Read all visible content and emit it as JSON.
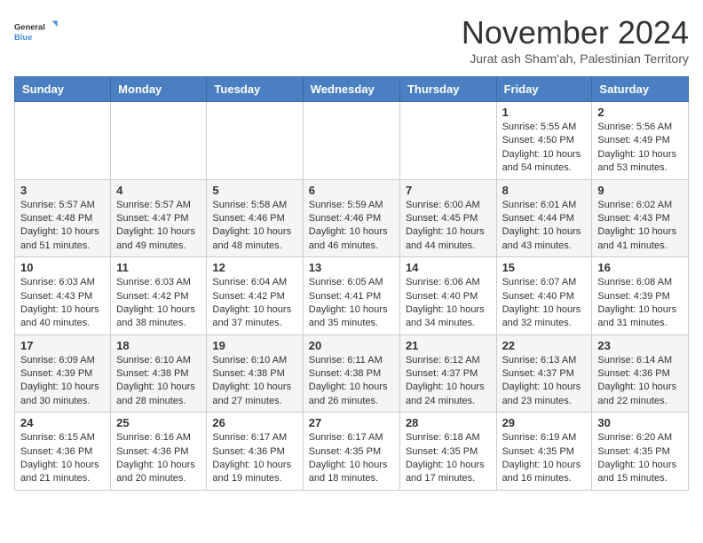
{
  "logo": {
    "text_general": "General",
    "text_blue": "Blue"
  },
  "title": "November 2024",
  "subtitle": "Jurat ash Sham'ah, Palestinian Territory",
  "days_of_week": [
    "Sunday",
    "Monday",
    "Tuesday",
    "Wednesday",
    "Thursday",
    "Friday",
    "Saturday"
  ],
  "weeks": [
    [
      {
        "day": "",
        "info": ""
      },
      {
        "day": "",
        "info": ""
      },
      {
        "day": "",
        "info": ""
      },
      {
        "day": "",
        "info": ""
      },
      {
        "day": "",
        "info": ""
      },
      {
        "day": "1",
        "info": "Sunrise: 5:55 AM\nSunset: 4:50 PM\nDaylight: 10 hours and 54 minutes."
      },
      {
        "day": "2",
        "info": "Sunrise: 5:56 AM\nSunset: 4:49 PM\nDaylight: 10 hours and 53 minutes."
      }
    ],
    [
      {
        "day": "3",
        "info": "Sunrise: 5:57 AM\nSunset: 4:48 PM\nDaylight: 10 hours and 51 minutes."
      },
      {
        "day": "4",
        "info": "Sunrise: 5:57 AM\nSunset: 4:47 PM\nDaylight: 10 hours and 49 minutes."
      },
      {
        "day": "5",
        "info": "Sunrise: 5:58 AM\nSunset: 4:46 PM\nDaylight: 10 hours and 48 minutes."
      },
      {
        "day": "6",
        "info": "Sunrise: 5:59 AM\nSunset: 4:46 PM\nDaylight: 10 hours and 46 minutes."
      },
      {
        "day": "7",
        "info": "Sunrise: 6:00 AM\nSunset: 4:45 PM\nDaylight: 10 hours and 44 minutes."
      },
      {
        "day": "8",
        "info": "Sunrise: 6:01 AM\nSunset: 4:44 PM\nDaylight: 10 hours and 43 minutes."
      },
      {
        "day": "9",
        "info": "Sunrise: 6:02 AM\nSunset: 4:43 PM\nDaylight: 10 hours and 41 minutes."
      }
    ],
    [
      {
        "day": "10",
        "info": "Sunrise: 6:03 AM\nSunset: 4:43 PM\nDaylight: 10 hours and 40 minutes."
      },
      {
        "day": "11",
        "info": "Sunrise: 6:03 AM\nSunset: 4:42 PM\nDaylight: 10 hours and 38 minutes."
      },
      {
        "day": "12",
        "info": "Sunrise: 6:04 AM\nSunset: 4:42 PM\nDaylight: 10 hours and 37 minutes."
      },
      {
        "day": "13",
        "info": "Sunrise: 6:05 AM\nSunset: 4:41 PM\nDaylight: 10 hours and 35 minutes."
      },
      {
        "day": "14",
        "info": "Sunrise: 6:06 AM\nSunset: 4:40 PM\nDaylight: 10 hours and 34 minutes."
      },
      {
        "day": "15",
        "info": "Sunrise: 6:07 AM\nSunset: 4:40 PM\nDaylight: 10 hours and 32 minutes."
      },
      {
        "day": "16",
        "info": "Sunrise: 6:08 AM\nSunset: 4:39 PM\nDaylight: 10 hours and 31 minutes."
      }
    ],
    [
      {
        "day": "17",
        "info": "Sunrise: 6:09 AM\nSunset: 4:39 PM\nDaylight: 10 hours and 30 minutes."
      },
      {
        "day": "18",
        "info": "Sunrise: 6:10 AM\nSunset: 4:38 PM\nDaylight: 10 hours and 28 minutes."
      },
      {
        "day": "19",
        "info": "Sunrise: 6:10 AM\nSunset: 4:38 PM\nDaylight: 10 hours and 27 minutes."
      },
      {
        "day": "20",
        "info": "Sunrise: 6:11 AM\nSunset: 4:38 PM\nDaylight: 10 hours and 26 minutes."
      },
      {
        "day": "21",
        "info": "Sunrise: 6:12 AM\nSunset: 4:37 PM\nDaylight: 10 hours and 24 minutes."
      },
      {
        "day": "22",
        "info": "Sunrise: 6:13 AM\nSunset: 4:37 PM\nDaylight: 10 hours and 23 minutes."
      },
      {
        "day": "23",
        "info": "Sunrise: 6:14 AM\nSunset: 4:36 PM\nDaylight: 10 hours and 22 minutes."
      }
    ],
    [
      {
        "day": "24",
        "info": "Sunrise: 6:15 AM\nSunset: 4:36 PM\nDaylight: 10 hours and 21 minutes."
      },
      {
        "day": "25",
        "info": "Sunrise: 6:16 AM\nSunset: 4:36 PM\nDaylight: 10 hours and 20 minutes."
      },
      {
        "day": "26",
        "info": "Sunrise: 6:17 AM\nSunset: 4:36 PM\nDaylight: 10 hours and 19 minutes."
      },
      {
        "day": "27",
        "info": "Sunrise: 6:17 AM\nSunset: 4:35 PM\nDaylight: 10 hours and 18 minutes."
      },
      {
        "day": "28",
        "info": "Sunrise: 6:18 AM\nSunset: 4:35 PM\nDaylight: 10 hours and 17 minutes."
      },
      {
        "day": "29",
        "info": "Sunrise: 6:19 AM\nSunset: 4:35 PM\nDaylight: 10 hours and 16 minutes."
      },
      {
        "day": "30",
        "info": "Sunrise: 6:20 AM\nSunset: 4:35 PM\nDaylight: 10 hours and 15 minutes."
      }
    ]
  ]
}
